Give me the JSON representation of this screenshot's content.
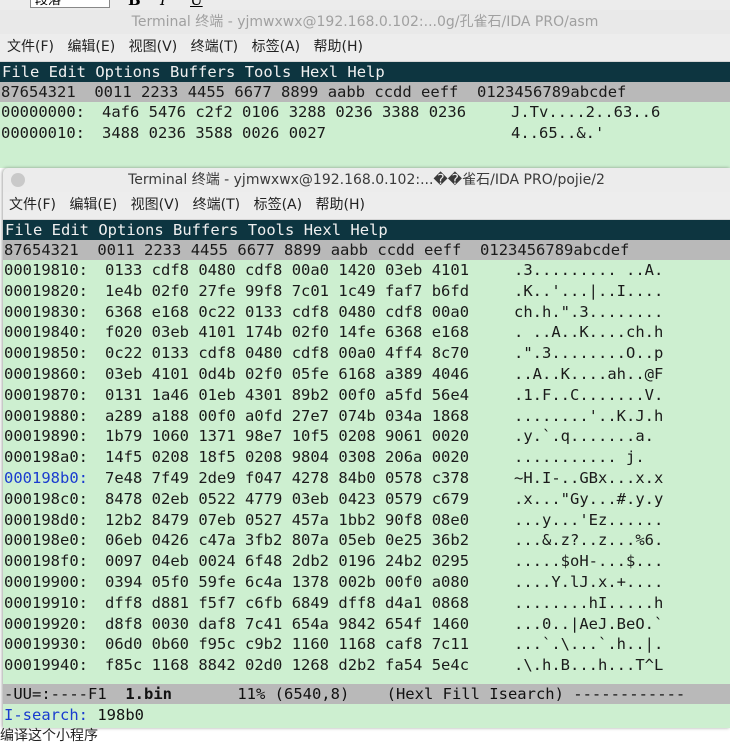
{
  "background": {
    "combo_label": "段落",
    "format_glyphs": [
      "B",
      "I",
      "U"
    ],
    "bottom_text": "编译这个小程序"
  },
  "windows": [
    {
      "title": "Terminal 终端 - yjmwxwx@192.168.0.102:...0g/孔雀石/IDA PRO/asm",
      "menu": [
        "文件(F)",
        "编辑(E)",
        "视图(V)",
        "终端(T)",
        "标签(A)",
        "帮助(H)"
      ],
      "emacs_menu": [
        "File",
        "Edit",
        "Options",
        "Buffers",
        "Tools",
        "Hexl",
        "Help"
      ],
      "header": {
        "addr": "87654321",
        "cols": [
          "0011",
          "2233",
          "4455",
          "6677",
          "8899",
          "aabb",
          "ccdd",
          "eeff"
        ],
        "ascii": "0123456789abcdef"
      },
      "rows": [
        {
          "addr": "00000000:",
          "hex": [
            "4af6",
            "5476",
            "c2f2",
            "0106",
            "3288",
            "0236",
            "3388",
            "0236"
          ],
          "ascii": "J.Tv....2..63..6"
        },
        {
          "addr": "00000010:",
          "hex": [
            "3488",
            "0236",
            "3588",
            "0026",
            "0027"
          ],
          "ascii": "4..65..&.'"
        }
      ]
    },
    {
      "title": "Terminal 终端 - yjmwxwx@192.168.0.102:...��雀石/IDA PRO/pojie/2",
      "menu": [
        "文件(F)",
        "编辑(E)",
        "视图(V)",
        "终端(T)",
        "标签(A)",
        "帮助(H)"
      ],
      "emacs_menu": [
        "File",
        "Edit",
        "Options",
        "Buffers",
        "Tools",
        "Hexl",
        "Help"
      ],
      "header": {
        "addr": "87654321",
        "cols": [
          "0011",
          "2233",
          "4455",
          "6677",
          "8899",
          "aabb",
          "ccdd",
          "eeff"
        ],
        "ascii": "0123456789abcdef"
      },
      "rows": [
        {
          "addr": "00019810:",
          "hex": [
            "0133",
            "cdf8",
            "0480",
            "cdf8",
            "00a0",
            "1420",
            "03eb",
            "4101"
          ],
          "ascii": ".3......... ..A."
        },
        {
          "addr": "00019820:",
          "hex": [
            "1e4b",
            "02f0",
            "27fe",
            "99f8",
            "7c01",
            "1c49",
            "faf7",
            "b6fd"
          ],
          "ascii": ".K..'...|..I...."
        },
        {
          "addr": "00019830:",
          "hex": [
            "6368",
            "e168",
            "0c22",
            "0133",
            "cdf8",
            "0480",
            "cdf8",
            "00a0"
          ],
          "ascii": "ch.h.\".3........"
        },
        {
          "addr": "00019840:",
          "hex": [
            "f020",
            "03eb",
            "4101",
            "174b",
            "02f0",
            "14fe",
            "6368",
            "e168"
          ],
          "ascii": ". ..A..K....ch.h"
        },
        {
          "addr": "00019850:",
          "hex": [
            "0c22",
            "0133",
            "cdf8",
            "0480",
            "cdf8",
            "00a0",
            "4ff4",
            "8c70"
          ],
          "ascii": ".\".3........O..p"
        },
        {
          "addr": "00019860:",
          "hex": [
            "03eb",
            "4101",
            "0d4b",
            "02f0",
            "05fe",
            "6168",
            "a389",
            "4046"
          ],
          "ascii": "..A..K....ah..@F"
        },
        {
          "addr": "00019870:",
          "hex": [
            "0131",
            "1a46",
            "01eb",
            "4301",
            "89b2",
            "00f0",
            "a5fd",
            "56e4"
          ],
          "ascii": ".1.F..C.......V."
        },
        {
          "addr": "00019880:",
          "hex": [
            "a289",
            "a188",
            "00f0",
            "a0fd",
            "27e7",
            "074b",
            "034a",
            "1868"
          ],
          "ascii": "........'..K.J.h"
        },
        {
          "addr": "00019890:",
          "hex": [
            "1b79",
            "1060",
            "1371",
            "98e7",
            "10f5",
            "0208",
            "9061",
            "0020"
          ],
          "ascii": ".y.`.q.......a. "
        },
        {
          "addr": "000198a0:",
          "hex": [
            "14f5",
            "0208",
            "18f5",
            "0208",
            "9804",
            "0308",
            "206a",
            "0020"
          ],
          "ascii": "........... j. "
        },
        {
          "addr": "000198b0:",
          "hex": [
            "7e48",
            "7f49",
            "2de9",
            "f047",
            "4278",
            "84b0",
            "0578",
            "c378"
          ],
          "ascii": "~H.I-..GBx...x.x"
        },
        {
          "addr": "000198c0:",
          "hex": [
            "8478",
            "02eb",
            "0522",
            "4779",
            "03eb",
            "0423",
            "0579",
            "c679"
          ],
          "ascii": ".x...\"Gy...#.y.y"
        },
        {
          "addr": "000198d0:",
          "hex": [
            "12b2",
            "8479",
            "07eb",
            "0527",
            "457a",
            "1bb2",
            "90f8",
            "08e0"
          ],
          "ascii": "...y...'Ez......"
        },
        {
          "addr": "000198e0:",
          "hex": [
            "06eb",
            "0426",
            "c47a",
            "3fb2",
            "807a",
            "05eb",
            "0e25",
            "36b2"
          ],
          "ascii": "...&.z?..z...%6."
        },
        {
          "addr": "000198f0:",
          "hex": [
            "0097",
            "04eb",
            "0024",
            "6f48",
            "2db2",
            "0196",
            "24b2",
            "0295"
          ],
          "ascii": ".....$oH-...$..."
        },
        {
          "addr": "00019900:",
          "hex": [
            "0394",
            "05f0",
            "59fe",
            "6c4a",
            "1378",
            "002b",
            "00f0",
            "a080"
          ],
          "ascii": "....Y.lJ.x.+...."
        },
        {
          "addr": "00019910:",
          "hex": [
            "dff8",
            "d881",
            "f5f7",
            "c6fb",
            "6849",
            "dff8",
            "d4a1",
            "0868"
          ],
          "ascii": "........hI.....h"
        },
        {
          "addr": "00019920:",
          "hex": [
            "d8f8",
            "0030",
            "daf8",
            "7c41",
            "654a",
            "9842",
            "654f",
            "1460"
          ],
          "ascii": "...0..|AeJ.BeO.`"
        },
        {
          "addr": "00019930:",
          "hex": [
            "06d0",
            "0b60",
            "f95c",
            "c9b2",
            "1160",
            "1168",
            "caf8",
            "7c11"
          ],
          "ascii": "...`.\\...`.h..|."
        },
        {
          "addr": "00019940:",
          "hex": [
            "f85c",
            "1168",
            "8842",
            "02d0",
            "1268",
            "d2b2",
            "fa54",
            "5e4c"
          ],
          "ascii": ".\\.h.B...h...T^L"
        }
      ],
      "modeline": {
        "prefix": "-UU=:----F1  ",
        "buffer": "1.bin",
        "suffix": "       11% (6540,8)    (Hexl Fill Isearch) ------------"
      },
      "minibuffer": {
        "prompt": "I-search:",
        "value": " 198b0"
      }
    }
  ]
}
